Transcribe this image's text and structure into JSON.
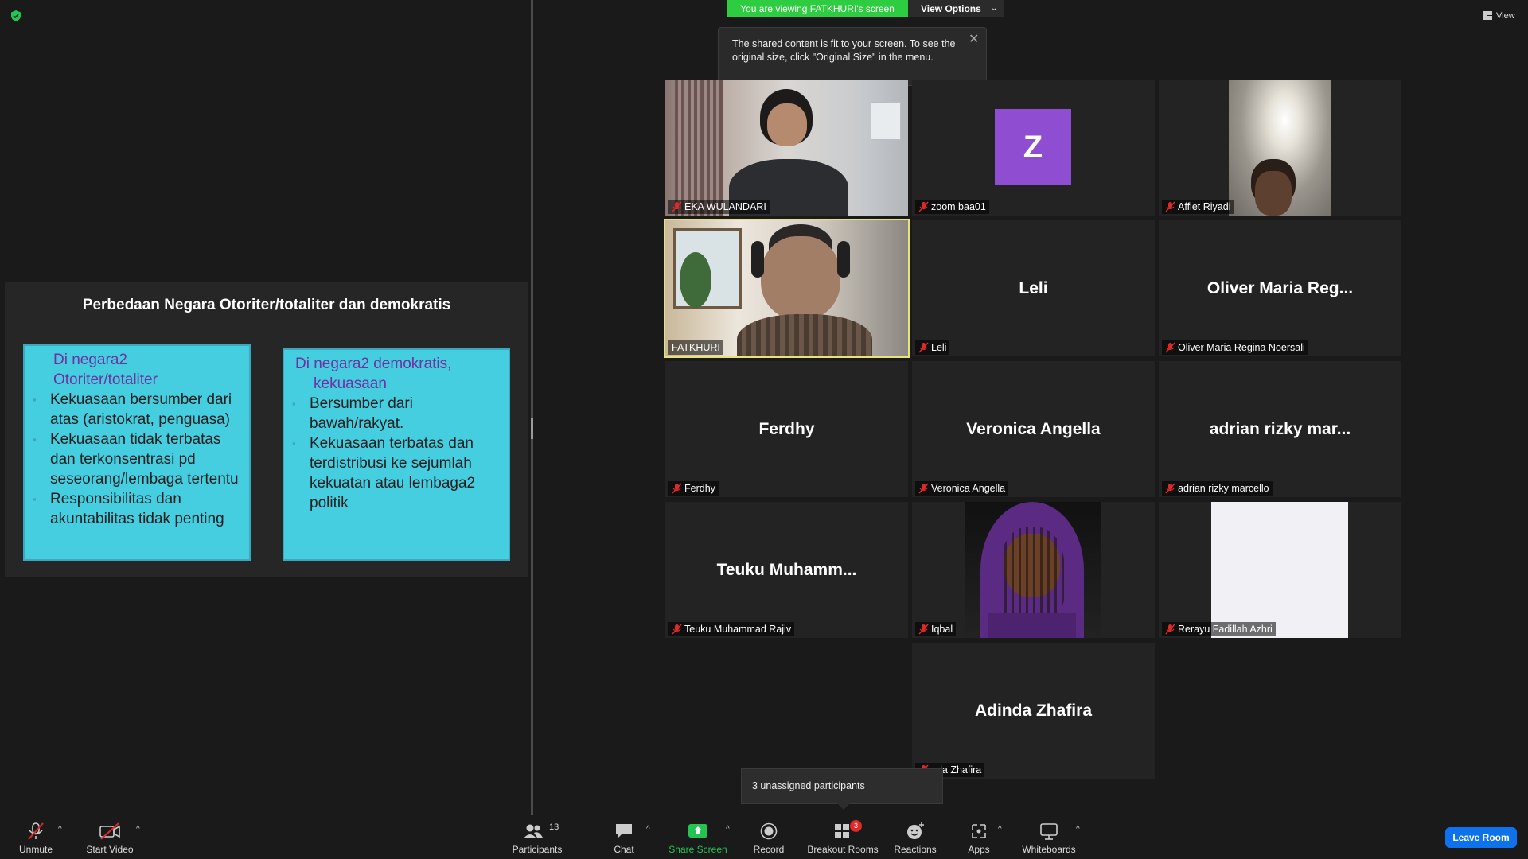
{
  "banner": {
    "viewing_text": "You are viewing FATKHURI's screen",
    "view_options_label": "View Options"
  },
  "toast": {
    "message": "The shared content is fit to your screen. To see the original size, click \"Original Size\" in the menu."
  },
  "view_button_label": "View",
  "slide": {
    "title": "Perbedaan Negara Otoriter/totaliter dan demokratis",
    "left": {
      "heading_line1": "Di negara2",
      "heading_line2": "Otoriter/totaliter",
      "bullets": [
        "Kekuasaan bersumber dari atas (aristokrat, penguasa)",
        "Kekuasaan tidak terbatas dan terkonsentrasi pd seseorang/lembaga tertentu",
        "Responsibilitas dan akuntabilitas tidak penting"
      ]
    },
    "right": {
      "heading_line1": "Di negara2 demokratis,",
      "heading_line2": "kekuasaan",
      "bullets": [
        "Bersumber dari bawah/rakyat.",
        "Kekuasaan terbatas dan terdistribusi ke sejumlah kekuatan atau lembaga2 politik"
      ]
    }
  },
  "participants": [
    {
      "name": "EKA WULANDARI",
      "center": "",
      "muted": true
    },
    {
      "name": "zoom baa01",
      "center": "Z",
      "muted": true
    },
    {
      "name": "Affiet Riyadi",
      "center": "",
      "muted": true
    },
    {
      "name": "FATKHURI",
      "center": "",
      "muted": false
    },
    {
      "name": "Leli",
      "center": "Leli",
      "muted": true
    },
    {
      "name": "Oliver Maria Regina Noersali",
      "center": "Oliver Maria Reg...",
      "muted": true
    },
    {
      "name": "Ferdhy",
      "center": "Ferdhy",
      "muted": true
    },
    {
      "name": "Veronica Angella",
      "center": "Veronica Angella",
      "muted": true
    },
    {
      "name": "adrian rizky marcello",
      "center": "adrian rizky mar...",
      "muted": true
    },
    {
      "name": "Teuku Muhammad Rajiv",
      "center": "Teuku  Muhamm...",
      "muted": true
    },
    {
      "name": "Iqbal",
      "center": "",
      "muted": true
    },
    {
      "name": "Rerayu Fadillah Azhri",
      "center": "",
      "muted": true
    },
    {
      "name": "nda Zhafira",
      "center": "Adinda Zhafira",
      "muted": true
    }
  ],
  "unassigned_tooltip": "3 unassigned participants",
  "toolbar": {
    "unmute": "Unmute",
    "start_video": "Start Video",
    "participants": "Participants",
    "participants_count": "13",
    "chat": "Chat",
    "share_screen": "Share Screen",
    "record": "Record",
    "breakout_rooms": "Breakout Rooms",
    "breakout_badge": "3",
    "reactions": "Reactions",
    "apps": "Apps",
    "whiteboards": "Whiteboards",
    "leave_room": "Leave Room"
  },
  "colors": {
    "share_banner": "#2ecc40",
    "slide_box": "#45cde0",
    "slide_heading": "#7030a0",
    "active_speaker": "#e7e27a",
    "leave_button": "#0e72ed",
    "mute_red": "#e02828"
  }
}
